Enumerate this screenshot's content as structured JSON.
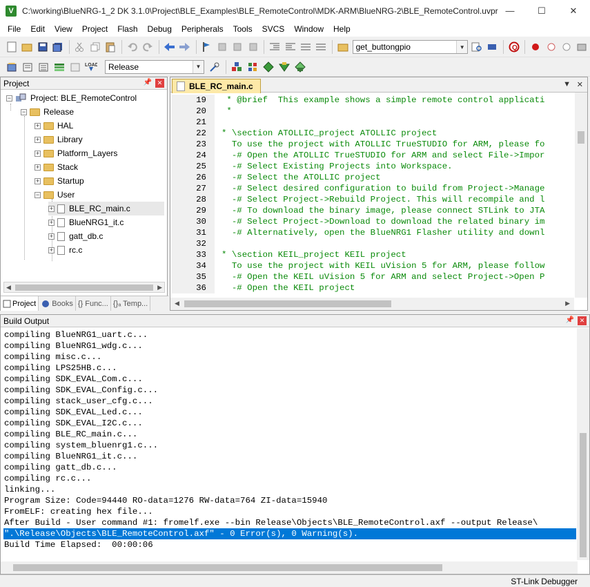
{
  "window": {
    "title": "C:\\working\\BlueNRG-1_2 DK 3.1.0\\Project\\BLE_Examples\\BLE_RemoteControl\\MDK-ARM\\BlueNRG-2\\BLE_RemoteControl.uvpr...",
    "app_icon": "V",
    "minimize": "—",
    "maximize": "☐",
    "close": "✕"
  },
  "menu": [
    "File",
    "Edit",
    "View",
    "Project",
    "Flash",
    "Debug",
    "Peripherals",
    "Tools",
    "SVCS",
    "Window",
    "Help"
  ],
  "toolbar1": {
    "find_combo_value": "get_buttongpio"
  },
  "toolbar2": {
    "target_combo_value": "Release"
  },
  "project_panel": {
    "title": "Project",
    "tree": [
      {
        "label": "Project: BLE_RemoteControl"
      },
      {
        "label": "Release"
      },
      {
        "label": "HAL"
      },
      {
        "label": "Library"
      },
      {
        "label": "Platform_Layers"
      },
      {
        "label": "Stack"
      },
      {
        "label": "Startup"
      },
      {
        "label": "User"
      },
      {
        "label": "BLE_RC_main.c"
      },
      {
        "label": "BlueNRG1_it.c"
      },
      {
        "label": "gatt_db.c"
      },
      {
        "label": "rc.c"
      }
    ],
    "tabs": [
      "Project",
      "Books",
      "{} Func...",
      "{}ₐ Temp..."
    ]
  },
  "editor": {
    "active_tab": "BLE_RC_main.c",
    "lines": [
      {
        "n": "19",
        "t": " * @brief  This example shows a simple remote control applicati"
      },
      {
        "n": "20",
        "t": " *"
      },
      {
        "n": "21",
        "t": ""
      },
      {
        "n": "22",
        "t": "* \\section ATOLLIC_project ATOLLIC project"
      },
      {
        "n": "23",
        "t": "  To use the project with ATOLLIC TrueSTUDIO for ARM, please fo"
      },
      {
        "n": "24",
        "t": "  -# Open the ATOLLIC TrueSTUDIO for ARM and select File->Impor"
      },
      {
        "n": "25",
        "t": "  -# Select Existing Projects into Workspace."
      },
      {
        "n": "26",
        "t": "  -# Select the ATOLLIC project"
      },
      {
        "n": "27",
        "t": "  -# Select desired configuration to build from Project->Manage"
      },
      {
        "n": "28",
        "t": "  -# Select Project->Rebuild Project. This will recompile and l"
      },
      {
        "n": "29",
        "t": "  -# To download the binary image, please connect STLink to JTA"
      },
      {
        "n": "30",
        "t": "  -# Select Project->Download to download the related binary im"
      },
      {
        "n": "31",
        "t": "  -# Alternatively, open the BlueNRG1 Flasher utility and downl"
      },
      {
        "n": "32",
        "t": ""
      },
      {
        "n": "33",
        "t": "* \\section KEIL_project KEIL project"
      },
      {
        "n": "34",
        "t": "  To use the project with KEIL uVision 5 for ARM, please follow"
      },
      {
        "n": "35",
        "t": "  -# Open the KEIL uVision 5 for ARM and select Project->Open P"
      },
      {
        "n": "36",
        "t": "  -# Open the KEIL project"
      }
    ]
  },
  "build_output": {
    "title": "Build Output",
    "lines": [
      "compiling BlueNRG1_uart.c...",
      "compiling BlueNRG1_wdg.c...",
      "compiling misc.c...",
      "compiling LPS25HB.c...",
      "compiling SDK_EVAL_Com.c...",
      "compiling SDK_EVAL_Config.c...",
      "compiling stack_user_cfg.c...",
      "compiling SDK_EVAL_Led.c...",
      "compiling SDK_EVAL_I2C.c...",
      "compiling BLE_RC_main.c...",
      "compiling system_bluenrg1.c...",
      "compiling BlueNRG1_it.c...",
      "compiling gatt_db.c...",
      "compiling rc.c...",
      "linking...",
      "Program Size: Code=94440 RO-data=1276 RW-data=764 ZI-data=15940",
      "FromELF: creating hex file...",
      "After Build - User command #1: fromelf.exe --bin Release\\Objects\\BLE_RemoteControl.axf --output Release\\",
      "\".\\Release\\Objects\\BLE_RemoteControl.axf\" - 0 Error(s), 0 Warning(s).",
      "Build Time Elapsed:  00:00:06"
    ]
  },
  "status_bar": {
    "debugger": "ST-Link Debugger"
  }
}
